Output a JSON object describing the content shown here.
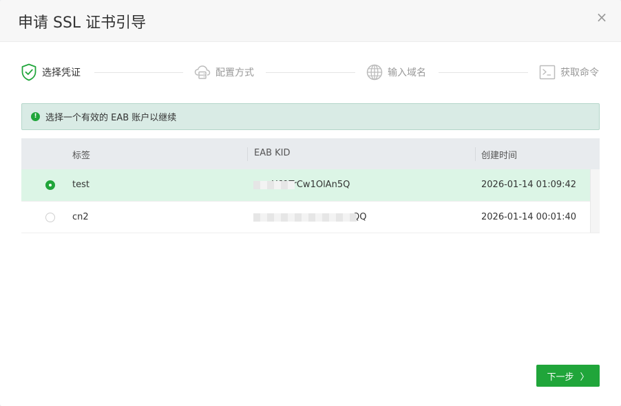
{
  "dialog": {
    "title": "申请 SSL 证书引导",
    "close_glyph": "×"
  },
  "steps": [
    {
      "label": "选择凭证",
      "icon": "shield-check-icon",
      "state": "active"
    },
    {
      "label": "配置方式",
      "icon": "cloud-server-icon",
      "state": "inactive"
    },
    {
      "label": "输入域名",
      "icon": "globe-icon",
      "state": "inactive"
    },
    {
      "label": "获取命令",
      "icon": "terminal-icon",
      "state": "inactive"
    }
  ],
  "alert": {
    "icon": "info-icon",
    "glyph": "!",
    "text": "选择一个有效的 EAB 账户以继续"
  },
  "table": {
    "columns": [
      "标签",
      "EAB KID",
      "创建时间"
    ],
    "rows": [
      {
        "selected": true,
        "label": "test",
        "kid_visible": "Y61TrCw1OlAn5Q",
        "created": "2026-01-14 01:09:42"
      },
      {
        "selected": false,
        "label": "cn2",
        "kid_visible": "QQ",
        "created": "2026-01-14 00:01:40"
      }
    ]
  },
  "footer": {
    "next_label": "下一步",
    "next_chevron": "〉"
  },
  "colors": {
    "accent": "#20a53a",
    "selected_row": "#dcf5e6",
    "alert_bg": "#d9ebe5",
    "inactive_icon": "#bbbbbb"
  }
}
